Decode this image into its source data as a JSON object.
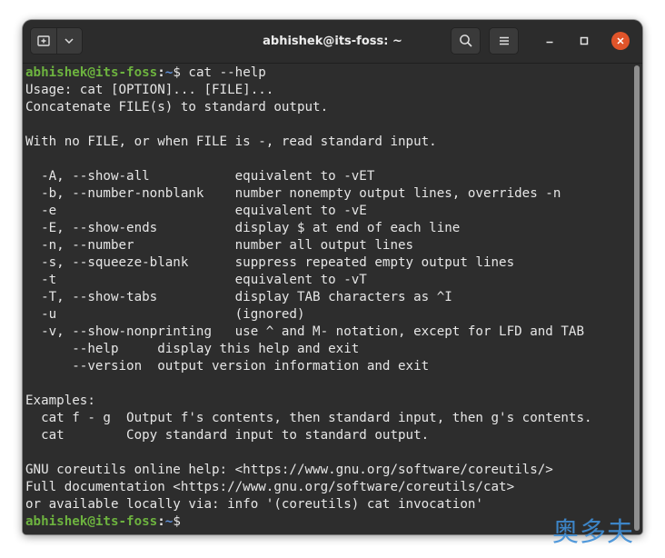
{
  "window": {
    "title": "abhishek@its-foss: ~"
  },
  "titlebar": {
    "new_tab_icon": "new-tab-icon",
    "menu_dropdown_icon": "chevron-down-icon",
    "search_icon": "search-icon",
    "hamburger_icon": "hamburger-menu-icon",
    "minimize_icon": "minimize-icon",
    "maximize_icon": "maximize-icon",
    "close_icon": "close-icon"
  },
  "prompt": {
    "user_host": "abhishek@its-foss",
    "separator": ":",
    "path": "~",
    "symbol": "$"
  },
  "terminal": {
    "command": " cat --help",
    "output_lines": [
      "Usage: cat [OPTION]... [FILE]...",
      "Concatenate FILE(s) to standard output.",
      "",
      "With no FILE, or when FILE is -, read standard input.",
      "",
      "  -A, --show-all           equivalent to -vET",
      "  -b, --number-nonblank    number nonempty output lines, overrides -n",
      "  -e                       equivalent to -vE",
      "  -E, --show-ends          display $ at end of each line",
      "  -n, --number             number all output lines",
      "  -s, --squeeze-blank      suppress repeated empty output lines",
      "  -t                       equivalent to -vT",
      "  -T, --show-tabs          display TAB characters as ^I",
      "  -u                       (ignored)",
      "  -v, --show-nonprinting   use ^ and M- notation, except for LFD and TAB",
      "      --help     display this help and exit",
      "      --version  output version information and exit",
      "",
      "Examples:",
      "  cat f - g  Output f's contents, then standard input, then g's contents.",
      "  cat        Copy standard input to standard output.",
      "",
      "GNU coreutils online help: <https://www.gnu.org/software/coreutils/>",
      "Full documentation <https://www.gnu.org/software/coreutils/cat>",
      "or available locally via: info '(coreutils) cat invocation'"
    ],
    "final_command": ""
  },
  "watermark": {
    "text": "奥多夫"
  },
  "colors": {
    "prompt_user": "#6db33f",
    "prompt_path": "#5f8fd6",
    "terminal_bg": "#2d2d2d",
    "close_button": "#e0542a"
  }
}
